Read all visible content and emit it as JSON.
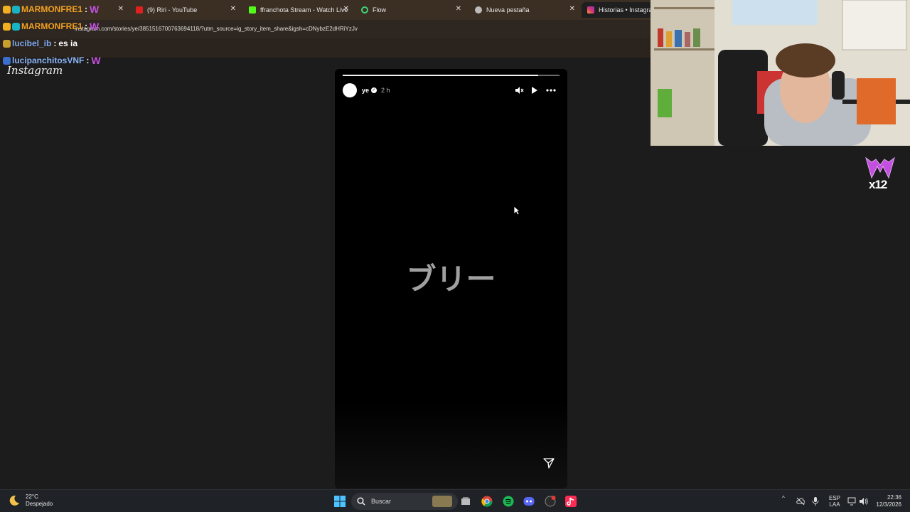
{
  "browser": {
    "tabs": [
      {
        "title": "",
        "active": false
      },
      {
        "title": "(9) Riri - YouTube",
        "active": false
      },
      {
        "title": "ffranchota Stream - Watch Live",
        "active": false
      },
      {
        "title": "Flow",
        "active": false
      },
      {
        "title": "Nueva pestaña",
        "active": false
      },
      {
        "title": "Historias • Instagram",
        "active": true
      }
    ],
    "url": "instagram.com/stories/ye/3851516700763694118/?utm_source=ig_story_item_share&igsh=cDNybzE2dHRiYzJv"
  },
  "chat": {
    "messages": [
      {
        "user": "MARMONFRE1",
        "sep": ":",
        "text": "",
        "user_color": "#f0a020"
      },
      {
        "user": "MARMONFRE1",
        "sep": ":",
        "text": "",
        "user_color": "#f0a020"
      },
      {
        "user": "lucibel_ib",
        "sep": ":",
        "text": "es ia",
        "user_color": "#7aa9f0"
      },
      {
        "user": "lucipanchitosVNF",
        "sep": ":",
        "text": "",
        "user_color": "#8ab4f8"
      }
    ],
    "instagram_logo": "Instagram"
  },
  "story": {
    "username": "ye",
    "time": "2 h",
    "text": "ブリー",
    "progress": 0.9
  },
  "taskbar": {
    "weather_temp": "22°C",
    "weather_desc": "Despejado",
    "search_label": "Buscar",
    "lang_top": "ESP",
    "lang_bottom": "LAA",
    "time": "22:36",
    "date": "12/3/2026"
  },
  "sub_badge": {
    "label": "x12"
  },
  "colors": {
    "accent_purple": "#c34fe0",
    "taskbar_bg": "#1f2327",
    "tabbar_bg": "#3b2f24"
  }
}
